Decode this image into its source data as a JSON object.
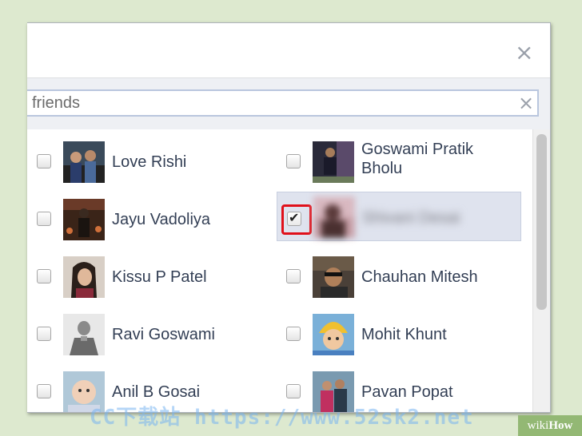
{
  "dialog": {
    "close_glyph": "×"
  },
  "search": {
    "value": "friends",
    "clear_glyph": "×"
  },
  "friends": [
    {
      "name": "Love Rishi",
      "checked": false,
      "avatar": "person-photo-icon"
    },
    {
      "name": "Goswami Pratik Bholu",
      "checked": false,
      "avatar": "person-photo-icon"
    },
    {
      "name": "Jayu Vadoliya",
      "checked": false,
      "avatar": "person-photo-icon"
    },
    {
      "name": "Shivani Desai",
      "checked": true,
      "blurred": true,
      "avatar": "person-photo-icon"
    },
    {
      "name": "Kissu P Patel",
      "checked": false,
      "avatar": "person-photo-icon"
    },
    {
      "name": "Chauhan Mitesh",
      "checked": false,
      "avatar": "person-photo-icon"
    },
    {
      "name": "Ravi Goswami",
      "checked": false,
      "avatar": "person-photo-icon"
    },
    {
      "name": "Mohit Khunt",
      "checked": false,
      "avatar": "person-photo-icon"
    },
    {
      "name": "Anil B Gosai",
      "checked": false,
      "avatar": "person-photo-icon"
    },
    {
      "name": "Pavan Popat",
      "checked": false,
      "avatar": "person-photo-icon"
    }
  ],
  "checkmark_glyph": "✔",
  "watermark": "CC下载站 https://www.52sk2.net",
  "branding": {
    "wiki": "wiki",
    "how": "How"
  },
  "colors": {
    "background": "#dde9cf",
    "highlight": "#e0101a",
    "selected_row": "#dfe3ee",
    "name_text": "#333f55"
  }
}
